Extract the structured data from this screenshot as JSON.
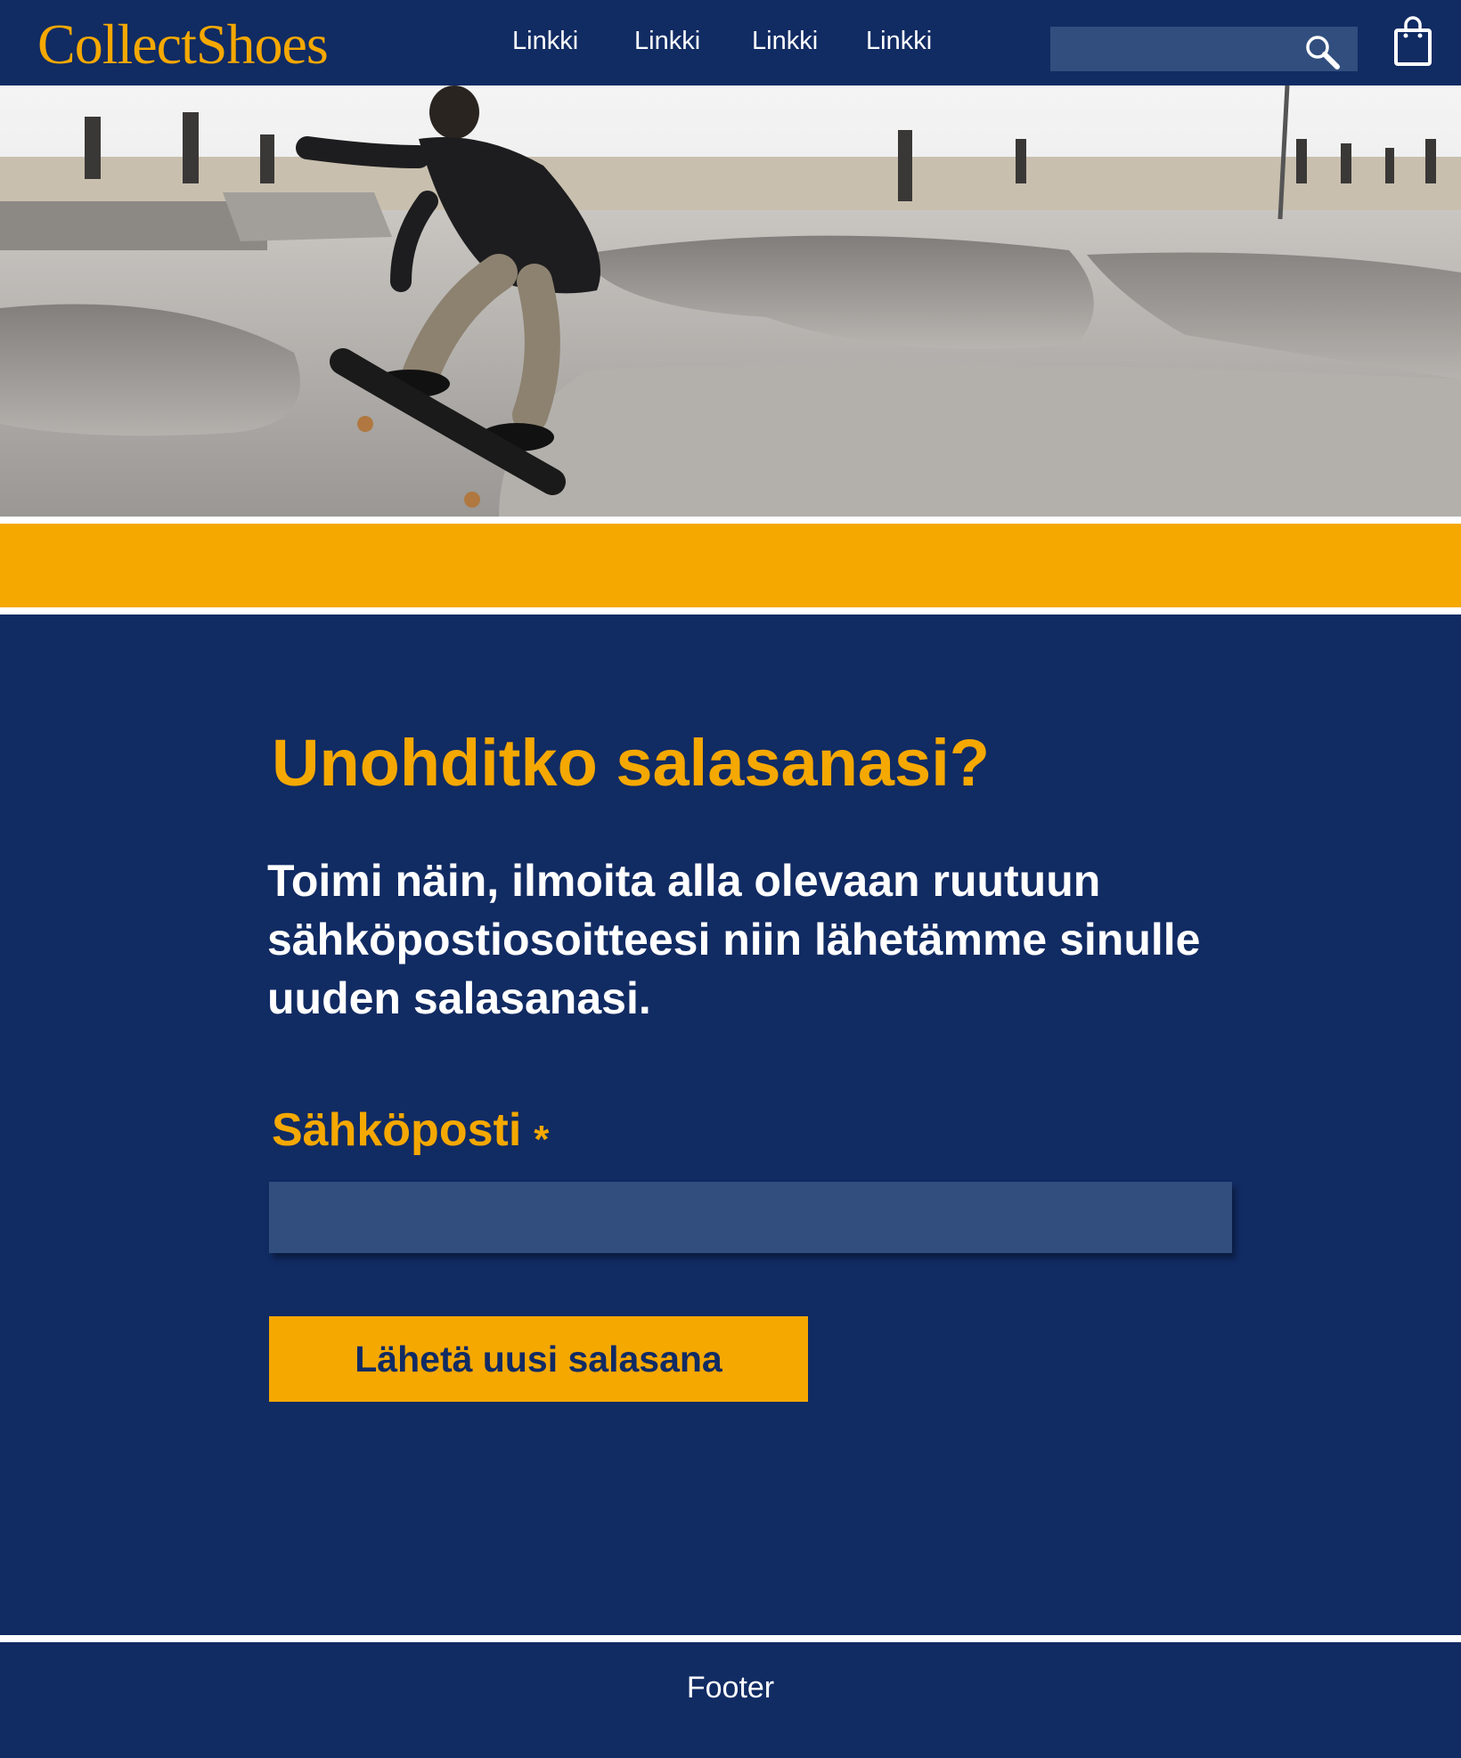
{
  "header": {
    "logo": "CollectShoes",
    "nav_links": [
      "Linkki",
      "Linkki",
      "Linkki",
      "Linkki"
    ],
    "search_value": "",
    "search_icon": "search-icon",
    "cart_icon": "shopping-bag-icon"
  },
  "hero": {
    "image": "skateboarder jumping in a concrete beach skatepark"
  },
  "main": {
    "title": "Unohditko salasanasi?",
    "instructions": "Toimi näin, ilmoita alla olevaan ruutuun sähköpostiosoitteesi niin lähetämme sinulle uuden salasanasi.",
    "email_label": "Sähköposti",
    "required_marker": "*",
    "email_value": "",
    "submit_label": "Lähetä uusi salasana"
  },
  "footer": {
    "text": "Footer"
  },
  "colors": {
    "navy": "#112b63",
    "accent": "#f5a800",
    "input_bg": "#314e7e",
    "white": "#ffffff"
  }
}
